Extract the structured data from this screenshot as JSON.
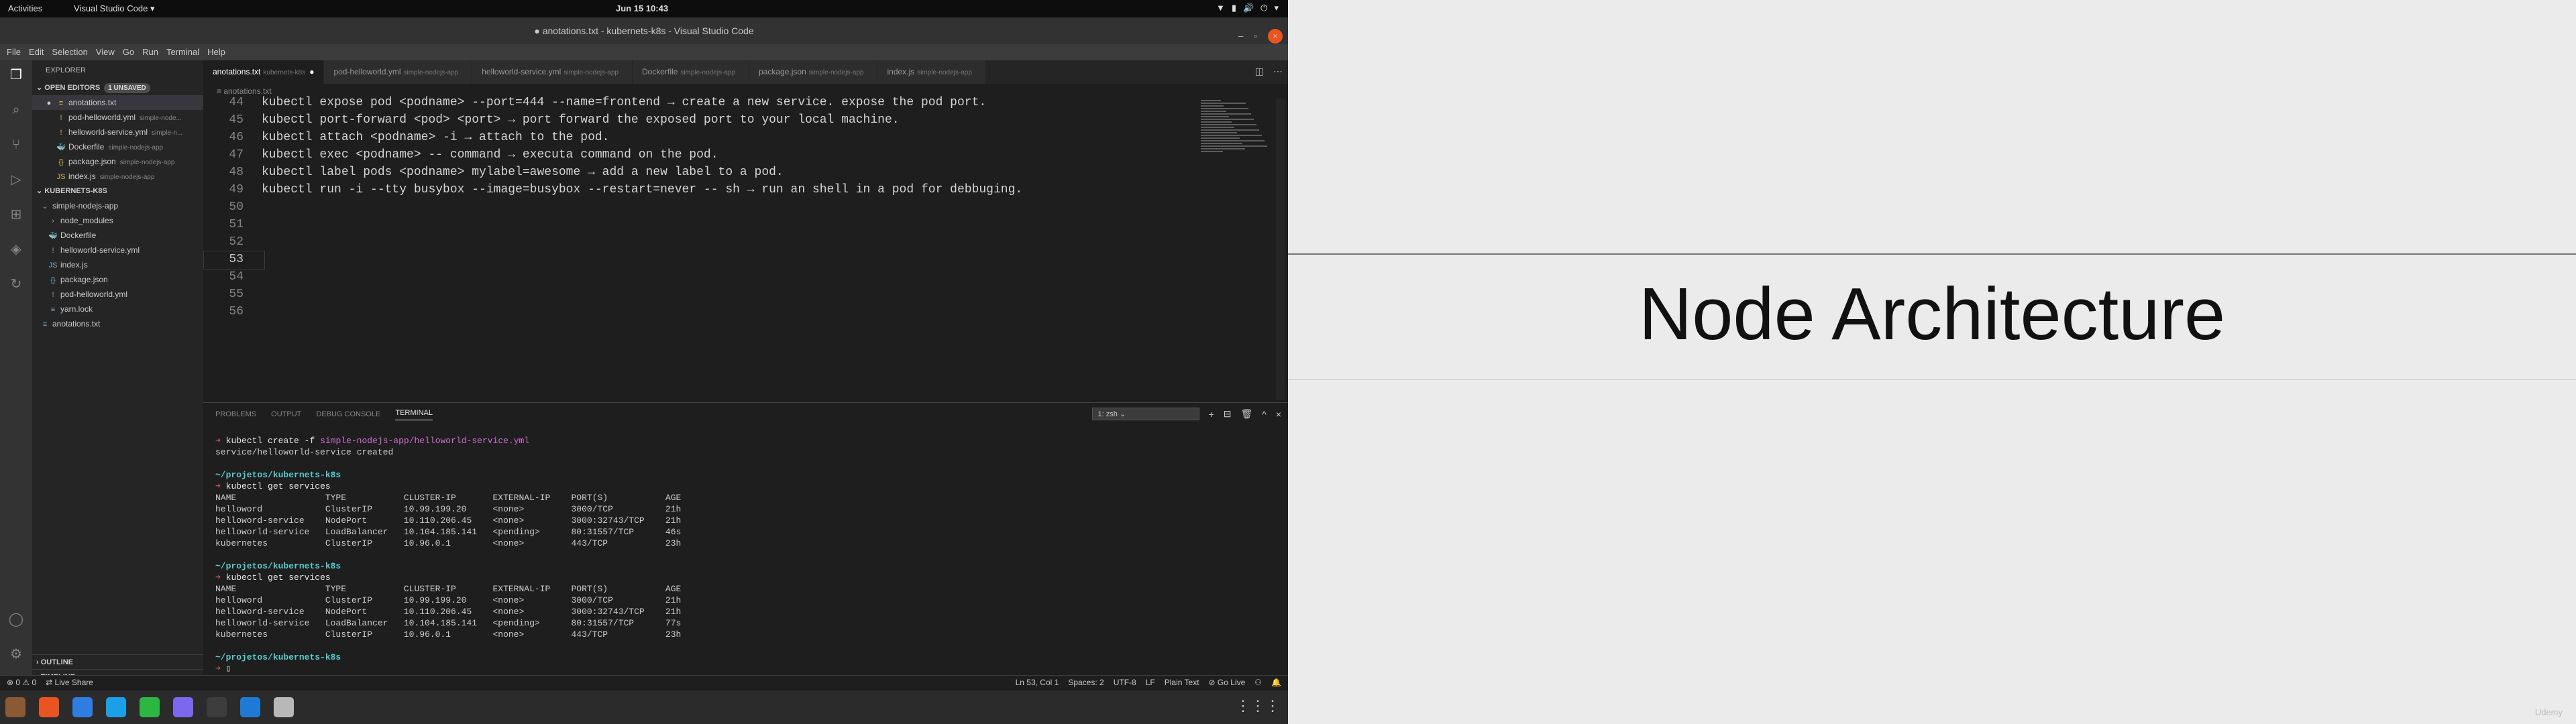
{
  "gnome": {
    "activities": "Activities",
    "app": "Visual Studio Code ▾",
    "clock": "Jun 15  10:43",
    "tray": [
      "▼",
      "▮",
      "🔊",
      "⏻",
      "▾"
    ]
  },
  "window": {
    "title": "● anotations.txt - kubernets-k8s - Visual Studio Code",
    "min": "–",
    "max": "▫",
    "close": "×"
  },
  "menu": [
    "File",
    "Edit",
    "Selection",
    "View",
    "Go",
    "Run",
    "Terminal",
    "Help"
  ],
  "sidebar": {
    "header": "EXPLORER",
    "open_editors": "OPEN EDITORS",
    "unsaved": "1 UNSAVED",
    "open_items": [
      {
        "icon": "≡",
        "name": "anotations.txt",
        "dir": "",
        "dot": "●"
      },
      {
        "icon": "!",
        "name": "pod-helloworld.yml",
        "dir": "simple-node...",
        "dot": ""
      },
      {
        "icon": "!",
        "name": "helloworld-service.yml",
        "dir": "simple-n...",
        "dot": ""
      },
      {
        "icon": "🐳",
        "name": "Dockerfile",
        "dir": "simple-nodejs-app",
        "dot": ""
      },
      {
        "icon": "{}",
        "name": "package.json",
        "dir": "simple-nodejs-app",
        "dot": ""
      },
      {
        "icon": "JS",
        "name": "index.js",
        "dir": "simple-nodejs-app",
        "dot": ""
      }
    ],
    "project": "KUBERNETS-K8S",
    "tree": [
      {
        "indent": 1,
        "icon": "⌄",
        "name": "simple-nodejs-app"
      },
      {
        "indent": 2,
        "icon": "›",
        "name": "node_modules"
      },
      {
        "indent": 2,
        "icon": "🐳",
        "name": "Dockerfile"
      },
      {
        "indent": 2,
        "icon": "!",
        "name": "helloworld-service.yml"
      },
      {
        "indent": 2,
        "icon": "JS",
        "name": "index.js"
      },
      {
        "indent": 2,
        "icon": "{}",
        "name": "package.json"
      },
      {
        "indent": 2,
        "icon": "!",
        "name": "pod-helloworld.yml"
      },
      {
        "indent": 2,
        "icon": "≡",
        "name": "yarn.lock"
      },
      {
        "indent": 1,
        "icon": "≡",
        "name": "anotations.txt"
      }
    ],
    "outline": "OUTLINE",
    "timeline": "TIMELINE"
  },
  "tabs": [
    {
      "name": "anotations.txt",
      "dir": "kubernets-k8s",
      "active": true,
      "mark": "●"
    },
    {
      "name": "pod-helloworld.yml",
      "dir": "simple-nodejs-app",
      "active": false,
      "mark": ""
    },
    {
      "name": "helloworld-service.yml",
      "dir": "simple-nodejs-app",
      "active": false,
      "mark": ""
    },
    {
      "name": "Dockerfile",
      "dir": "simple-nodejs-app",
      "active": false,
      "mark": ""
    },
    {
      "name": "package.json",
      "dir": "simple-nodejs-app",
      "active": false,
      "mark": ""
    },
    {
      "name": "index.js",
      "dir": "simple-nodejs-app",
      "active": false,
      "mark": ""
    }
  ],
  "breadcrumb": "≡ anotations.txt",
  "code": [
    {
      "n": "44",
      "t": "kubectl expose pod <podname> --port=444 --name=frontend → create a new service. expose the pod port."
    },
    {
      "n": "45",
      "t": "kubectl port-forward <pod> <port> → port forward the exposed port to your local machine."
    },
    {
      "n": "46",
      "t": "kubectl attach <podname> -i → attach to the pod."
    },
    {
      "n": "47",
      "t": "kubectl exec <podname> -- command → executa command on the pod."
    },
    {
      "n": "48",
      "t": "kubectl label pods <podname> mylabel=awesome → add a new label to a pod."
    },
    {
      "n": "49",
      "t": "kubectl run -i --tty busybox --image=busybox --restart=never -- sh → run an shell in a pod for debbuging."
    },
    {
      "n": "50",
      "t": ""
    },
    {
      "n": "51",
      "t": ""
    },
    {
      "n": "52",
      "t": ""
    },
    {
      "n": "53",
      "t": "",
      "cur": true
    },
    {
      "n": "54",
      "t": ""
    },
    {
      "n": "55",
      "t": ""
    },
    {
      "n": "56",
      "t": ""
    }
  ],
  "panel": {
    "tabs": [
      "PROBLEMS",
      "OUTPUT",
      "DEBUG CONSOLE",
      "TERMINAL"
    ],
    "active": "TERMINAL",
    "shell": "1: zsh",
    "actions": [
      "+",
      "⊟",
      "🗑",
      "^",
      "×"
    ]
  },
  "terminal": [
    {
      "k": "cmd",
      "a": "➜ ",
      "c": "kubectl create -f ",
      "g": "simple-nodejs-app/helloworld-service.yml"
    },
    {
      "k": "out",
      "t": "service/helloworld-service created"
    },
    {
      "k": "out",
      "t": ""
    },
    {
      "k": "dir",
      "t": "~/projetos/kubernets-k8s"
    },
    {
      "k": "cmd",
      "a": "➜ ",
      "c": "kubectl get services",
      "g": ""
    },
    {
      "k": "out",
      "t": "NAME                 TYPE           CLUSTER-IP       EXTERNAL-IP    PORT(S)           AGE"
    },
    {
      "k": "out",
      "t": "helloword            ClusterIP      10.99.199.20     <none>         3000/TCP          21h"
    },
    {
      "k": "out",
      "t": "helloword-service    NodePort       10.110.206.45    <none>         3000:32743/TCP    21h"
    },
    {
      "k": "out",
      "t": "helloworld-service   LoadBalancer   10.104.185.141   <pending>      80:31557/TCP      46s"
    },
    {
      "k": "out",
      "t": "kubernetes           ClusterIP      10.96.0.1        <none>         443/TCP           23h"
    },
    {
      "k": "out",
      "t": ""
    },
    {
      "k": "dir",
      "t": "~/projetos/kubernets-k8s"
    },
    {
      "k": "cmd",
      "a": "➜ ",
      "c": "kubectl get services",
      "g": ""
    },
    {
      "k": "out",
      "t": "NAME                 TYPE           CLUSTER-IP       EXTERNAL-IP    PORT(S)           AGE"
    },
    {
      "k": "out",
      "t": "helloword            ClusterIP      10.99.199.20     <none>         3000/TCP          21h"
    },
    {
      "k": "out",
      "t": "helloword-service    NodePort       10.110.206.45    <none>         3000:32743/TCP    21h"
    },
    {
      "k": "out",
      "t": "helloworld-service   LoadBalancer   10.104.185.141   <pending>      80:31557/TCP      77s"
    },
    {
      "k": "out",
      "t": "kubernetes           ClusterIP      10.96.0.1        <none>         443/TCP           23h"
    },
    {
      "k": "out",
      "t": ""
    },
    {
      "k": "dir",
      "t": "~/projetos/kubernets-k8s"
    },
    {
      "k": "cmd",
      "a": "➜ ",
      "c": "▯",
      "g": ""
    }
  ],
  "status": {
    "left": [
      "⊗ 0 ⚠ 0",
      "⇄ Live Share"
    ],
    "right": [
      "Ln 53, Col 1",
      "Spaces: 2",
      "UTF-8",
      "LF",
      "Plain Text",
      "⊘ Go Live",
      "⚇",
      "🔔"
    ]
  },
  "dock": {
    "colors": [
      "#8a5a34",
      "#e95420",
      "#2f7de1",
      "#1ba0e8",
      "#2cb742",
      "#7b68ee",
      "#3d3d3d",
      "#1f7ad6",
      "#b8b8b8"
    ],
    "apps_glyph": "⋮⋮⋮"
  },
  "slide": {
    "title": "Node Architecture",
    "watermark": "Udemy"
  }
}
